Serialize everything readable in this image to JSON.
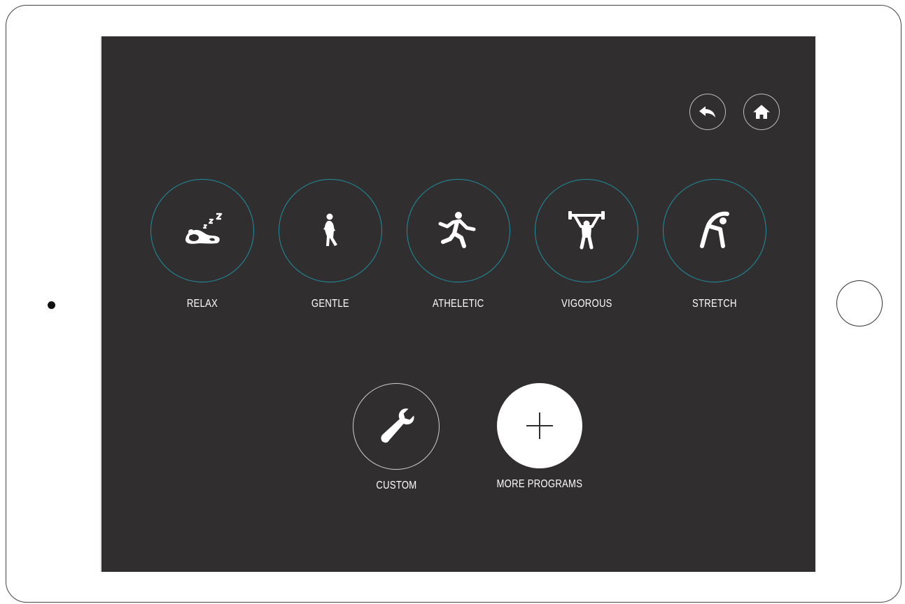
{
  "nav": {
    "back_icon": "back-arrow-icon",
    "home_icon": "home-icon"
  },
  "programs": [
    {
      "label": "RELAX",
      "icon": "sleep-icon"
    },
    {
      "label": "GENTLE",
      "icon": "walking-icon"
    },
    {
      "label": "ATHELETIC",
      "icon": "running-icon"
    },
    {
      "label": "VIGOROUS",
      "icon": "weightlifting-icon"
    },
    {
      "label": "STRETCH",
      "icon": "stretching-icon"
    }
  ],
  "actions": {
    "custom_label": "CUSTOM",
    "custom_icon": "wrench-icon",
    "more_label": "MORE PROGRAMS",
    "more_icon": "plus-icon"
  },
  "colors": {
    "screen_bg": "#302e2f",
    "ring_accent": "#1f8fa0",
    "text": "#ffffff"
  }
}
